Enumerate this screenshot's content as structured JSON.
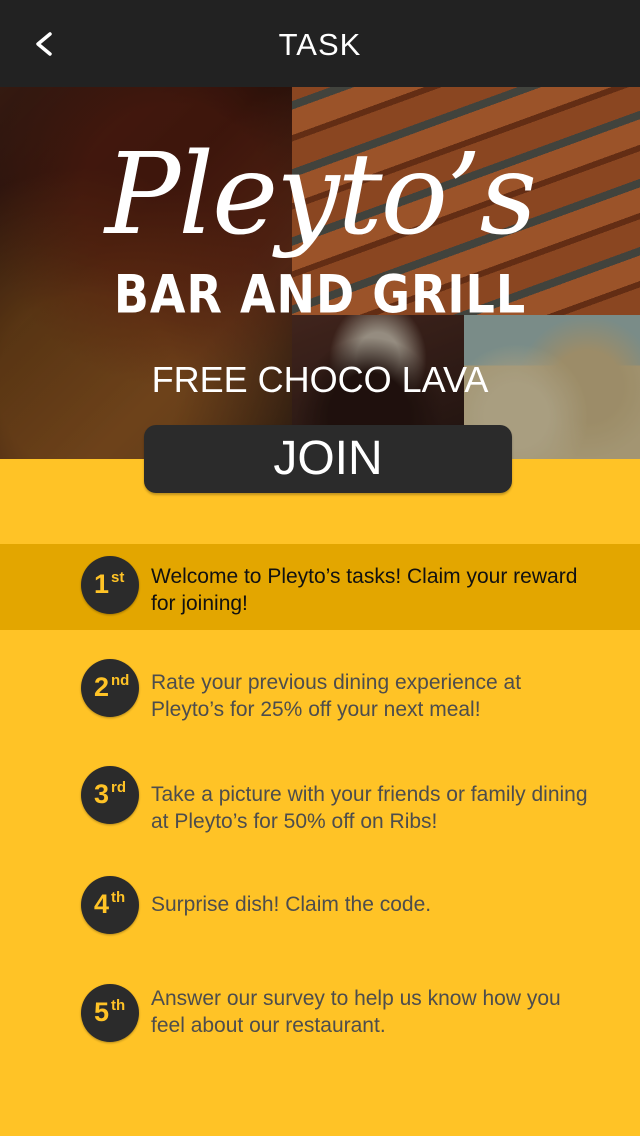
{
  "header": {
    "title": "TASK",
    "back_icon": "chevron-left-icon"
  },
  "hero": {
    "logo_script": "Pleyto’s",
    "logo_sub": "BAR AND GRILL",
    "promo": "FREE CHOCO LAVA",
    "join_label": "JOIN"
  },
  "colors": {
    "background": "#FFC326",
    "active_row": "#E3A600",
    "header": "#222222",
    "badge": "#2b2b2b"
  },
  "tasks": [
    {
      "num": "1",
      "suffix": "st",
      "text": "Welcome to Pleyto’s tasks! Claim your reward for joining!"
    },
    {
      "num": "2",
      "suffix": "nd",
      "text": "Rate your previous dining experience at Pleyto’s for 25% off your next meal!"
    },
    {
      "num": "3",
      "suffix": "rd",
      "text": "Take a picture with your friends or family dining at Pleyto’s for 50% off on Ribs!"
    },
    {
      "num": "4",
      "suffix": "th",
      "text": "Surprise dish! Claim the code."
    },
    {
      "num": "5",
      "suffix": "th",
      "text": "Answer our survey to help us know how you feel about our restaurant."
    }
  ]
}
